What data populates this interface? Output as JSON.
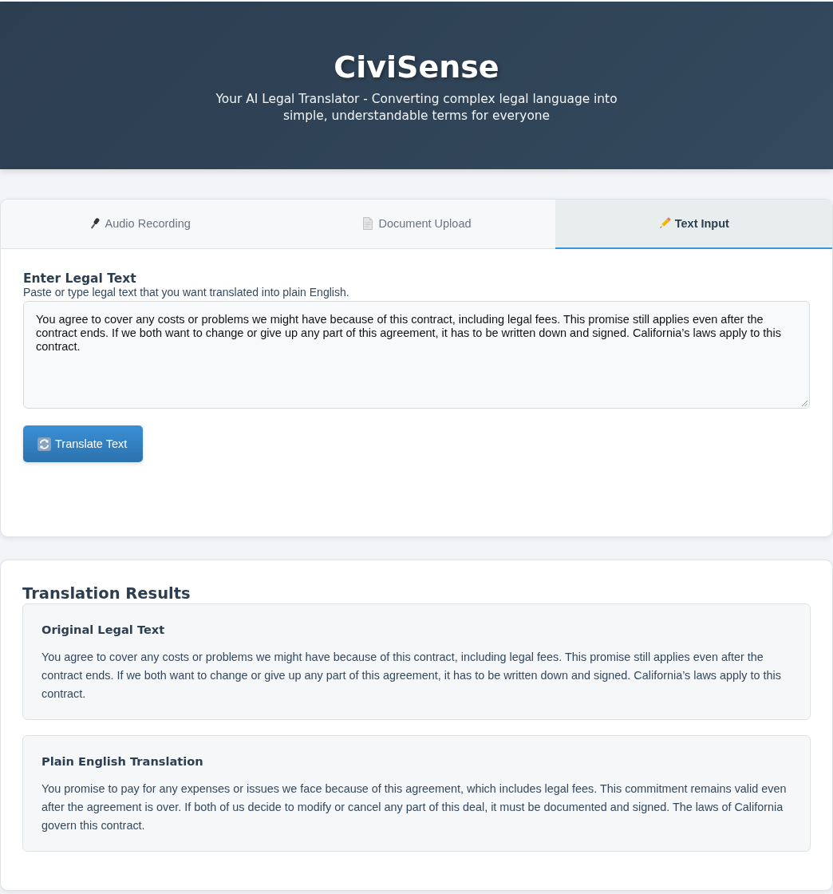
{
  "header": {
    "title": "CiviSense",
    "subtitle": "Your AI Legal Translator - Converting complex legal language into simple, understandable terms for everyone"
  },
  "tabs": [
    {
      "label": "Audio Recording",
      "selected": false
    },
    {
      "label": "Document Upload",
      "selected": false
    },
    {
      "label": "Text Input",
      "selected": true
    }
  ],
  "text_input": {
    "heading": "Enter Legal Text",
    "description": "Paste or type legal text that you want translated into plain English.",
    "value": "You agree to cover any costs or problems we might have because of this contract, including legal fees. This promise still applies even after the contract ends. If we both want to change or give up any part of this agreement, it has to be written down and signed. California’s laws apply to this contract.",
    "button": "Translate Text"
  },
  "results": {
    "heading": "Translation Results",
    "sections": [
      {
        "heading": "Original Legal Text",
        "text": "You agree to cover any costs or problems we might have because of this contract, including legal fees. This promise still applies even after the contract ends. If we both want to change or give up any part of this agreement, it has to be written down and signed. California’s laws apply to this contract."
      },
      {
        "heading": "Plain English Translation",
        "text": "You promise to pay for any expenses or issues we face because of this agreement, which includes legal fees. This commitment remains valid even after the agreement is over. If both of us decide to modify or cancel any part of this deal, it must be documented and signed. The laws of California govern this contract."
      }
    ]
  }
}
